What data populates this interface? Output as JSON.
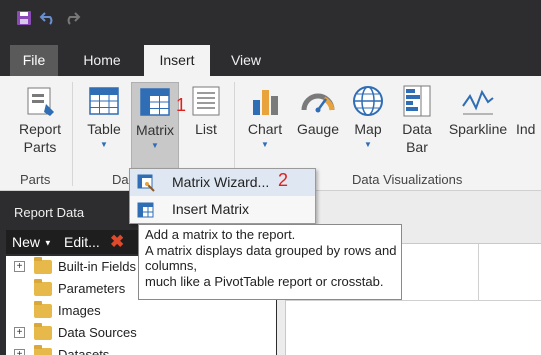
{
  "tabs": [
    {
      "label": "File"
    },
    {
      "label": "Home"
    },
    {
      "label": "Insert"
    },
    {
      "label": "View"
    }
  ],
  "ribbon": {
    "report_parts": {
      "label1": "Report",
      "label2": "Parts"
    },
    "table": {
      "label": "Table"
    },
    "matrix": {
      "label": "Matrix"
    },
    "list": {
      "label": "List"
    },
    "chart": {
      "label": "Chart"
    },
    "gauge": {
      "label": "Gauge"
    },
    "map": {
      "label": "Map"
    },
    "data_bar": {
      "label1": "Data",
      "label2": "Bar"
    },
    "sparkline": {
      "label": "Sparkline"
    },
    "indicator": {
      "label": "Ind"
    },
    "groups": {
      "parts": "Parts",
      "data_regions": "Da",
      "data_visualizations": "Data Visualizations"
    }
  },
  "markers": {
    "one": "1",
    "two": "2"
  },
  "menu": {
    "items": [
      {
        "label": "Matrix Wizard..."
      },
      {
        "label": "Insert Matrix"
      }
    ]
  },
  "tooltip": {
    "lines": [
      "Add a matrix to the report.",
      "A matrix displays data grouped by rows and",
      "columns,",
      "much like a PivotTable report or crosstab."
    ]
  },
  "report_data": {
    "title": "Report Data",
    "toolbar": {
      "new": "New",
      "edit": "Edit..."
    },
    "tree": [
      {
        "label": "Built-in Fields",
        "expandable": true
      },
      {
        "label": "Parameters",
        "expandable": false
      },
      {
        "label": "Images",
        "expandable": false
      },
      {
        "label": "Data Sources",
        "expandable": true
      },
      {
        "label": "Datasets",
        "expandable": true
      }
    ]
  },
  "colors": {
    "accent": "#2f6db5",
    "marker": "#e0201d",
    "save_icon": "#8a4bb6"
  }
}
